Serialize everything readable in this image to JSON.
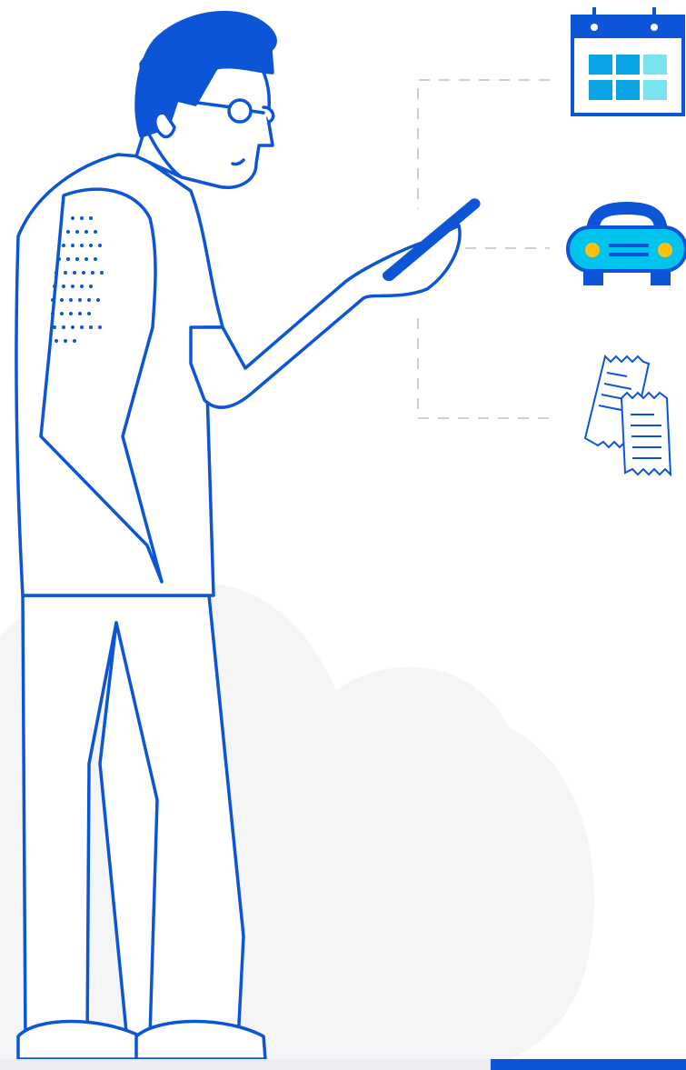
{
  "colors": {
    "primary_blue": "#0b55d6",
    "cloud_gray": "#f4f5f7",
    "calendar_tile_dark": "#0aa5e6",
    "calendar_tile_light": "#7be3f0",
    "car_body": "#00c4ee",
    "car_lights": "#ffc107",
    "connector_gray": "#cfcfcf",
    "background": "#ffffff"
  },
  "icons": [
    "calendar-icon",
    "car-icon",
    "receipts-icon",
    "smartphone-icon"
  ],
  "illustration": {
    "subject": "person-looking-at-phone"
  }
}
